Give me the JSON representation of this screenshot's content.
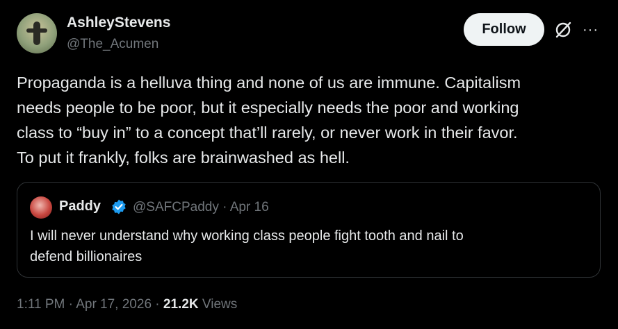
{
  "author": {
    "display_name": "AshleyStevens",
    "handle": "@The_Acumen"
  },
  "actions": {
    "follow_label": "Follow",
    "more_label": "···"
  },
  "tweet": {
    "lines": [
      "Propaganda is a helluva thing and none of us are immune. Capitalism",
      "needs people to be poor, but it especially needs the poor and working",
      "class to “buy in” to a concept that’ll rarely, or never work in their favor.",
      "To put it frankly, folks are brainwashed as hell."
    ]
  },
  "quote": {
    "display_name": "Paddy",
    "handle": "@SAFCPaddy",
    "separator": "·",
    "date": "Apr 16",
    "lines": [
      "I will never understand why working class people fight tooth and nail to",
      "defend billionaires"
    ]
  },
  "meta": {
    "time": "1:11 PM",
    "separator": "·",
    "date": "Apr 17, 2026",
    "views_count": "21.2K",
    "views_label": "Views"
  },
  "colors": {
    "background": "#000000",
    "text_primary": "#e7e9ea",
    "text_secondary": "#71767b",
    "verified": "#1d9bf0",
    "border": "#2f3336"
  },
  "icons": [
    "grok-icon",
    "more-icon",
    "verified-badge-icon"
  ]
}
